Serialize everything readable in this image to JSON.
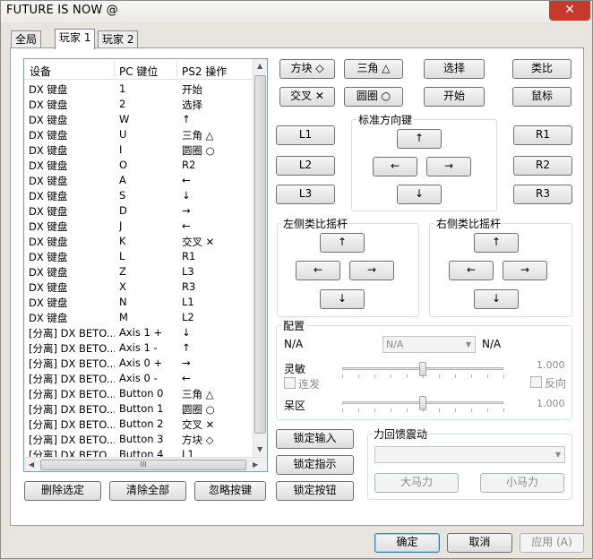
{
  "window": {
    "title": "FUTURE IS NOW @",
    "close_label": "✕"
  },
  "tabs": [
    "全局",
    "玩家 1",
    "玩家 2"
  ],
  "list": {
    "headers": [
      "设备",
      "PC 键位",
      "PS2 操作"
    ],
    "rows": [
      [
        "DX 键盘",
        "1",
        "开始"
      ],
      [
        "DX 键盘",
        "2",
        "选择"
      ],
      [
        "DX 键盘",
        "W",
        "↑"
      ],
      [
        "DX 键盘",
        "U",
        "三角 △"
      ],
      [
        "DX 键盘",
        "I",
        "圆圈 ○"
      ],
      [
        "DX 键盘",
        "O",
        "R2"
      ],
      [
        "DX 键盘",
        "A",
        "←"
      ],
      [
        "DX 键盘",
        "S",
        "↓"
      ],
      [
        "DX 键盘",
        "D",
        "→"
      ],
      [
        "DX 键盘",
        "J",
        "←"
      ],
      [
        "DX 键盘",
        "K",
        "交叉 ✕"
      ],
      [
        "DX 键盘",
        "L",
        "R1"
      ],
      [
        "DX 键盘",
        "Z",
        "L3"
      ],
      [
        "DX 键盘",
        "X",
        "R3"
      ],
      [
        "DX 键盘",
        "N",
        "L1"
      ],
      [
        "DX 键盘",
        "M",
        "L2"
      ],
      [
        "[分离] DX BETO...",
        "Axis 1 +",
        "↓"
      ],
      [
        "[分离] DX BETO...",
        "Axis 1 -",
        "↑"
      ],
      [
        "[分离] DX BETO...",
        "Axis 0 +",
        "→"
      ],
      [
        "[分离] DX BETO...",
        "Axis 0 -",
        "←"
      ],
      [
        "[分离] DX BETO...",
        "Button 0",
        "三角 △"
      ],
      [
        "[分离] DX BETO...",
        "Button 1",
        "圆圈 ○"
      ],
      [
        "[分离] DX BETO...",
        "Button 2",
        "交叉 ✕"
      ],
      [
        "[分离] DX BETO...",
        "Button 3",
        "方块 ◇"
      ],
      [
        "[分离] DX BETO...",
        "Button 4",
        "L1"
      ]
    ],
    "hscroll_grip": "III"
  },
  "list_buttons": {
    "delete": "删除选定",
    "clear": "清除全部",
    "ignore": "忽略按键"
  },
  "face_buttons": {
    "square": "方块 ◇",
    "triangle": "三角 △",
    "select": "选择",
    "analog": "类比",
    "cross": "交叉 ✕",
    "circle": "圆圈 ○",
    "start": "开始",
    "mouse": "鼠标"
  },
  "shoulder": {
    "l1": "L1",
    "l2": "L2",
    "l3": "L3",
    "r1": "R1",
    "r2": "R2",
    "r3": "R3"
  },
  "dpad": {
    "label": "标准方向键",
    "up": "↑",
    "left": "←",
    "right": "→",
    "down": "↓"
  },
  "left_stick": {
    "label": "左侧类比摇杆",
    "up": "↑",
    "left": "←",
    "right": "→",
    "down": "↓"
  },
  "right_stick": {
    "label": "右侧类比摇杆",
    "up": "↑",
    "left": "←",
    "right": "→",
    "down": "↓"
  },
  "config": {
    "label": "配置",
    "na_left": "N/A",
    "select_value": "N/A",
    "na_right": "N/A",
    "sensitivity_label": "灵敏",
    "sensitivity_value": "1.000",
    "turbo_label": "连发",
    "reverse_label": "反向",
    "deadzone_label": "呆区",
    "deadzone_value": "1.000",
    "sensitivity_level": 0.5,
    "deadzone_level": 0.5
  },
  "lock_buttons": {
    "input": "锁定输入",
    "indicator": "锁定指示",
    "button": "锁定按钮"
  },
  "force_feedback": {
    "label": "力回馈震动",
    "big": "大马力",
    "small": "小马力"
  },
  "dialog_buttons": {
    "ok": "确定",
    "cancel": "取消",
    "apply": "应用 (A)"
  }
}
